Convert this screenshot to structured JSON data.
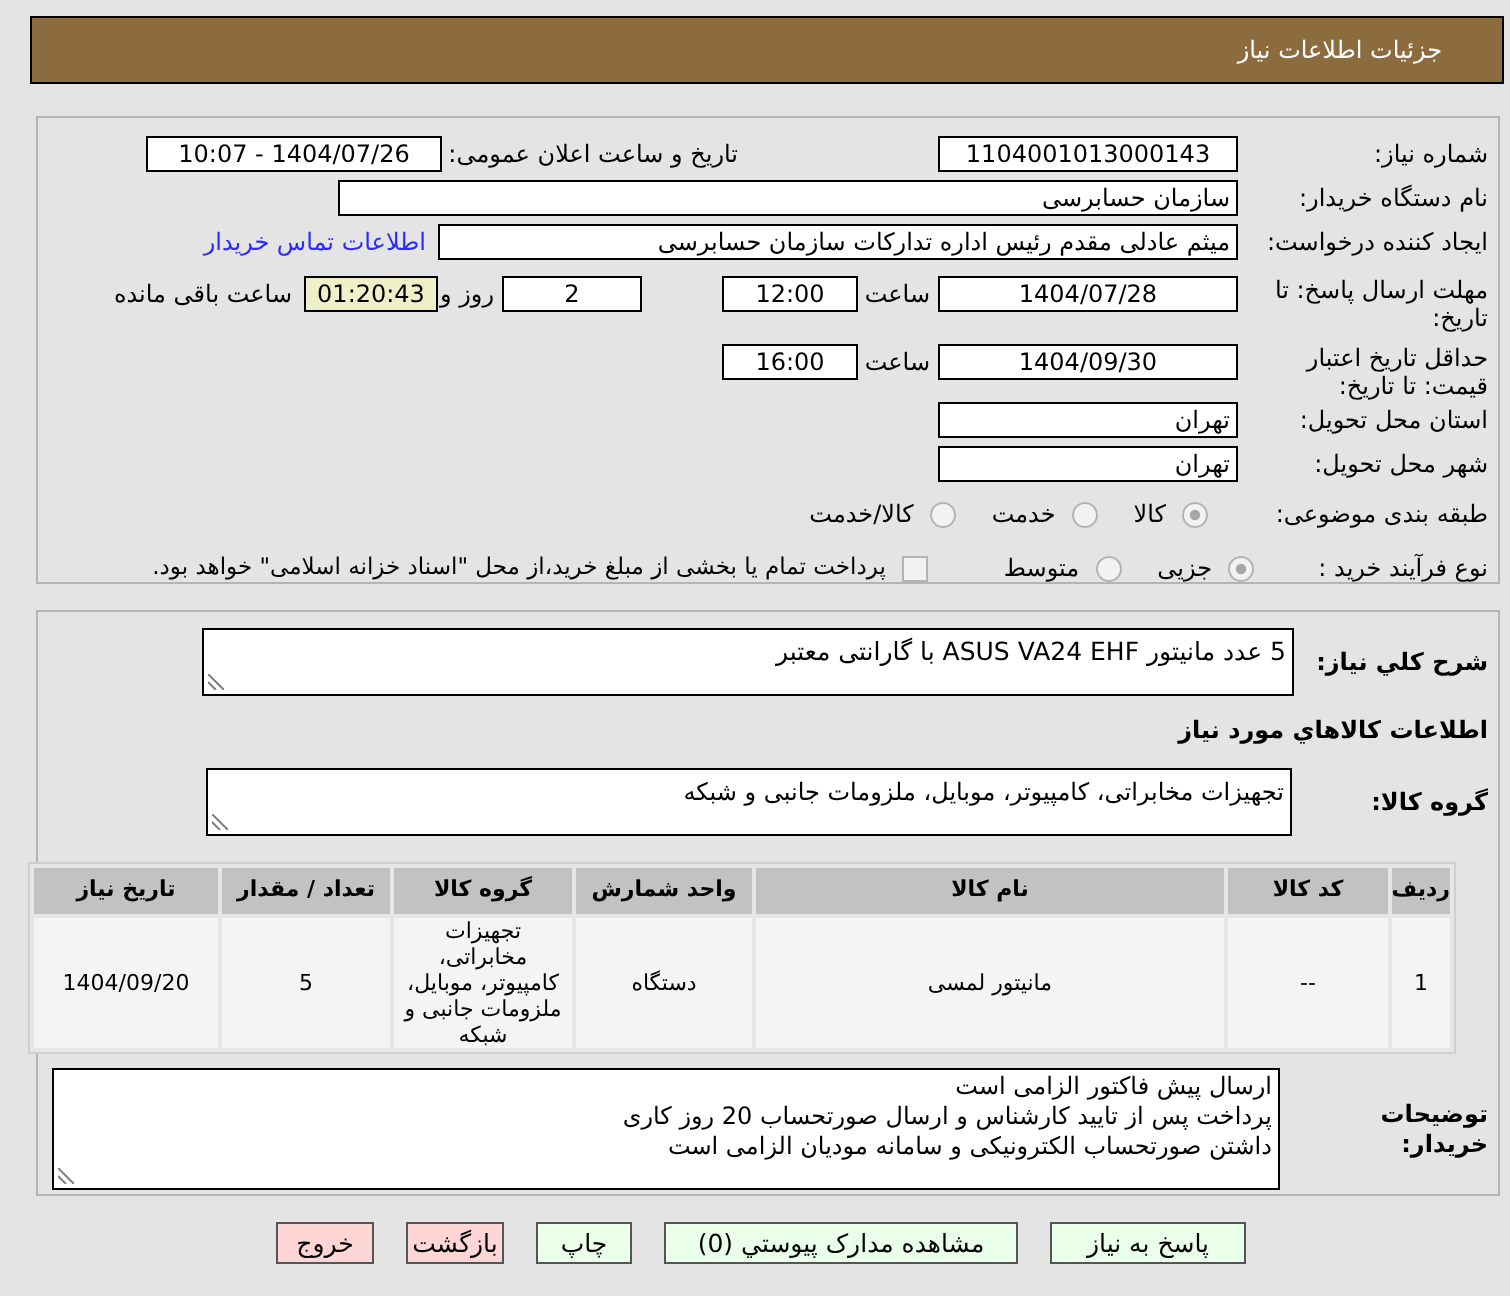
{
  "header": {
    "title": "جزئیات اطلاعات نیاز"
  },
  "details": {
    "need_number": {
      "label": "شماره نیاز:",
      "value": "1104001013000143"
    },
    "announcement": {
      "label": "تاریخ و ساعت اعلان عمومی:",
      "value": "1404/07/26 - 10:07"
    },
    "buyer": {
      "label": "نام دستگاه خریدار:",
      "value": "سازمان حسابرسی"
    },
    "requester": {
      "label": "ایجاد کننده درخواست:",
      "value": "میثم عادلی مقدم رئیس اداره تدارکات سازمان حسابرسی",
      "contact_link": "اطلاعات تماس خریدار"
    },
    "response_deadline": {
      "label": "مهلت ارسال پاسخ: تا تاریخ:",
      "date": "1404/07/28",
      "time_label": "ساعت",
      "time": "12:00",
      "days": "2",
      "days_label": "روز و",
      "remaining": "01:20:43",
      "remaining_label": "ساعت باقی مانده"
    },
    "price_validity": {
      "label": "حداقل تاریخ اعتبار قیمت: تا تاریخ:",
      "date": "1404/09/30",
      "time_label": "ساعت",
      "time": "16:00"
    },
    "province": {
      "label": "استان محل تحویل:",
      "value": "تهران"
    },
    "city": {
      "label": "شهر محل تحویل:",
      "value": "تهران"
    },
    "category": {
      "label": "طبقه بندی موضوعی:",
      "options": [
        {
          "label": "کالا",
          "selected": true
        },
        {
          "label": "خدمت",
          "selected": false
        },
        {
          "label": "کالا/خدمت",
          "selected": false
        }
      ]
    },
    "purchase_type": {
      "label": "نوع فرآیند خرید :",
      "options": [
        {
          "label": "جزیی",
          "selected": true
        },
        {
          "label": "متوسط",
          "selected": false
        }
      ],
      "treasury_payment": {
        "label": "پرداخت تمام یا بخشی از مبلغ خرید،از محل \"اسناد خزانه اسلامی\" خواهد بود.",
        "checked": false
      }
    }
  },
  "need": {
    "description": {
      "label": "شرح کلي نیاز:",
      "value": "5 عدد مانیتور ASUS VA24 EHF با گارانتی معتبر"
    },
    "goods_heading": "اطلاعات كالاهاي مورد نیاز",
    "goods_group": {
      "label": "گروه کالا:",
      "value": "تجهیزات مخابراتی، کامپیوتر، موبایل، ملزومات جانبی و شبکه"
    },
    "table": {
      "columns": [
        "ردیف",
        "کد کالا",
        "نام کالا",
        "واحد شمارش",
        "گروه کالا",
        "تعداد / مقدار",
        "تاریخ نیاز"
      ],
      "rows": [
        [
          "1",
          "--",
          "مانیتور لمسی",
          "دستگاه",
          "تجهیزات مخابراتی، کامپیوتر، موبایل، ملزومات جانبی و شبکه",
          "5",
          "1404/09/20"
        ]
      ]
    },
    "buyer_notes": {
      "label": "توضیحات خریدار:",
      "lines": [
        "ارسال پیش فاکتور الزامی است",
        "پرداخت پس از تایید کارشناس و ارسال صورتحساب 20 روز کاری",
        "داشتن صورتحساب الکترونیکی و سامانه مودیان الزامی است"
      ]
    }
  },
  "buttons": [
    {
      "label": "پاسخ به نیاز",
      "kind": "action"
    },
    {
      "label": "مشاهده مدارک پیوستي (0)",
      "kind": "action"
    },
    {
      "label": "چاپ",
      "kind": "action"
    },
    {
      "label": "بازگشت",
      "kind": "exit"
    },
    {
      "label": "خروج",
      "kind": "exit"
    }
  ]
}
